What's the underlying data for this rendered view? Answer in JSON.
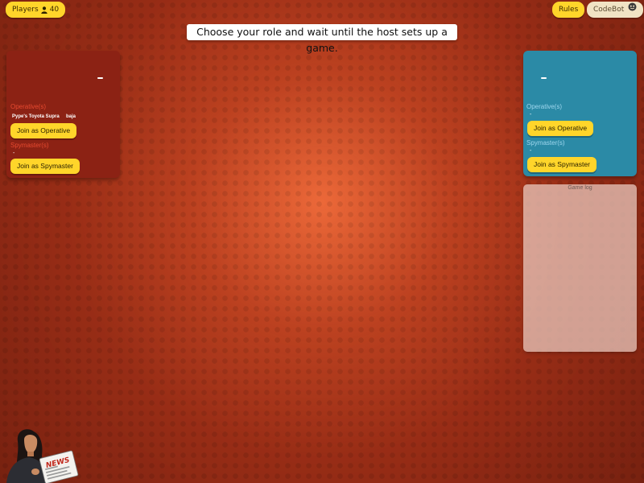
{
  "header": {
    "players_label": "Players",
    "players_count": "40",
    "rules_label": "Rules",
    "codebot_label": "CodeBot",
    "instruction": "Choose your role and wait until the host sets up a game."
  },
  "red_team": {
    "score": "-",
    "operatives_label": "Operative(s)",
    "operatives": [
      "Pype's Toyota Supra",
      "baja"
    ],
    "join_operative_label": "Join as Operative",
    "spymasters_label": "Spymaster(s)",
    "spymasters_value": "-",
    "join_spymaster_label": "Join as Spymaster"
  },
  "blue_team": {
    "score": "-",
    "operatives_label": "Operative(s)",
    "operatives_value": "-",
    "join_operative_label": "Join as Operative",
    "spymasters_label": "Spymaster(s)",
    "spymasters_value": "-",
    "join_spymaster_label": "Join as Spymaster"
  },
  "game_log": {
    "title": "Game log"
  },
  "news_badge": {
    "label": "NEWS"
  },
  "icons": {
    "players": "user-icon",
    "codebot": "robot-face-icon",
    "news": "newspaper-anchor-icon"
  },
  "colors": {
    "accent_yellow": "#ffd52a",
    "red_team": "#8c2214",
    "blue_team": "#2b8aa6",
    "background": "#b8421f"
  }
}
